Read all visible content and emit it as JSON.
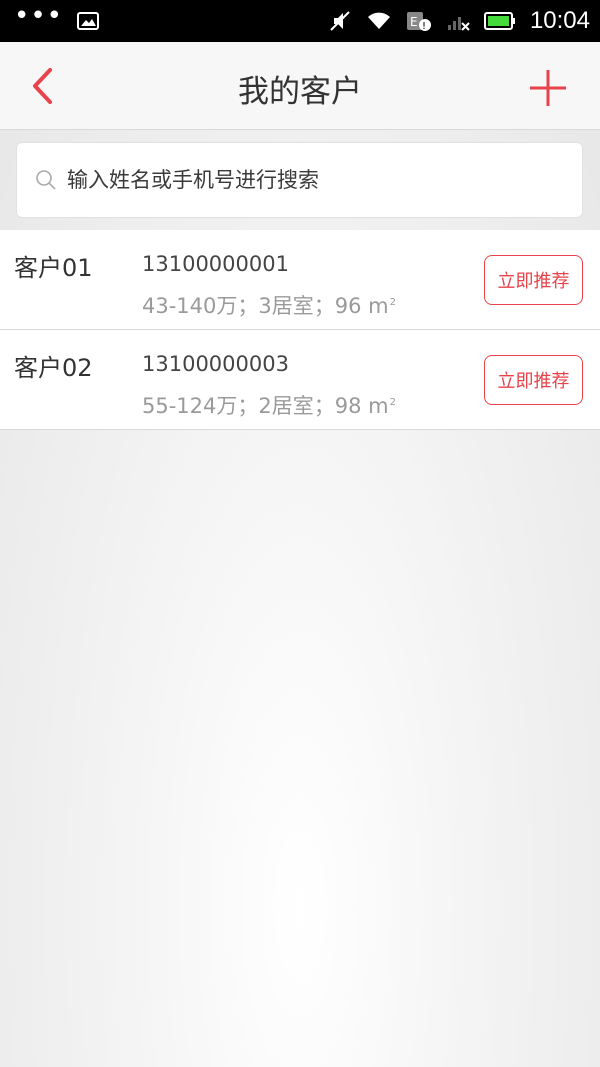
{
  "status_bar": {
    "time": "10:04",
    "icons": [
      "more-dots-icon",
      "image-icon",
      "mute-icon",
      "wifi-icon",
      "e-network-icon",
      "signal-icon",
      "battery-icon"
    ]
  },
  "header": {
    "title": "我的客户",
    "back_icon": "chevron-left-icon",
    "add_icon": "plus-icon"
  },
  "search": {
    "placeholder": "输入姓名或手机号进行搜索",
    "value": ""
  },
  "customers": [
    {
      "name": "客户01",
      "phone": "13100000001",
      "desc": "43-140万；3居室；96 m",
      "unit_sup": "2",
      "action_label": "立即推荐"
    },
    {
      "name": "客户02",
      "phone": "13100000003",
      "desc": "55-124万；2居室；98 m",
      "unit_sup": "2",
      "action_label": "立即推荐"
    }
  ],
  "colors": {
    "accent": "#e8434b",
    "header_bg": "#f7f7f7",
    "text_primary": "#333333",
    "text_secondary": "#9a9a9a"
  }
}
